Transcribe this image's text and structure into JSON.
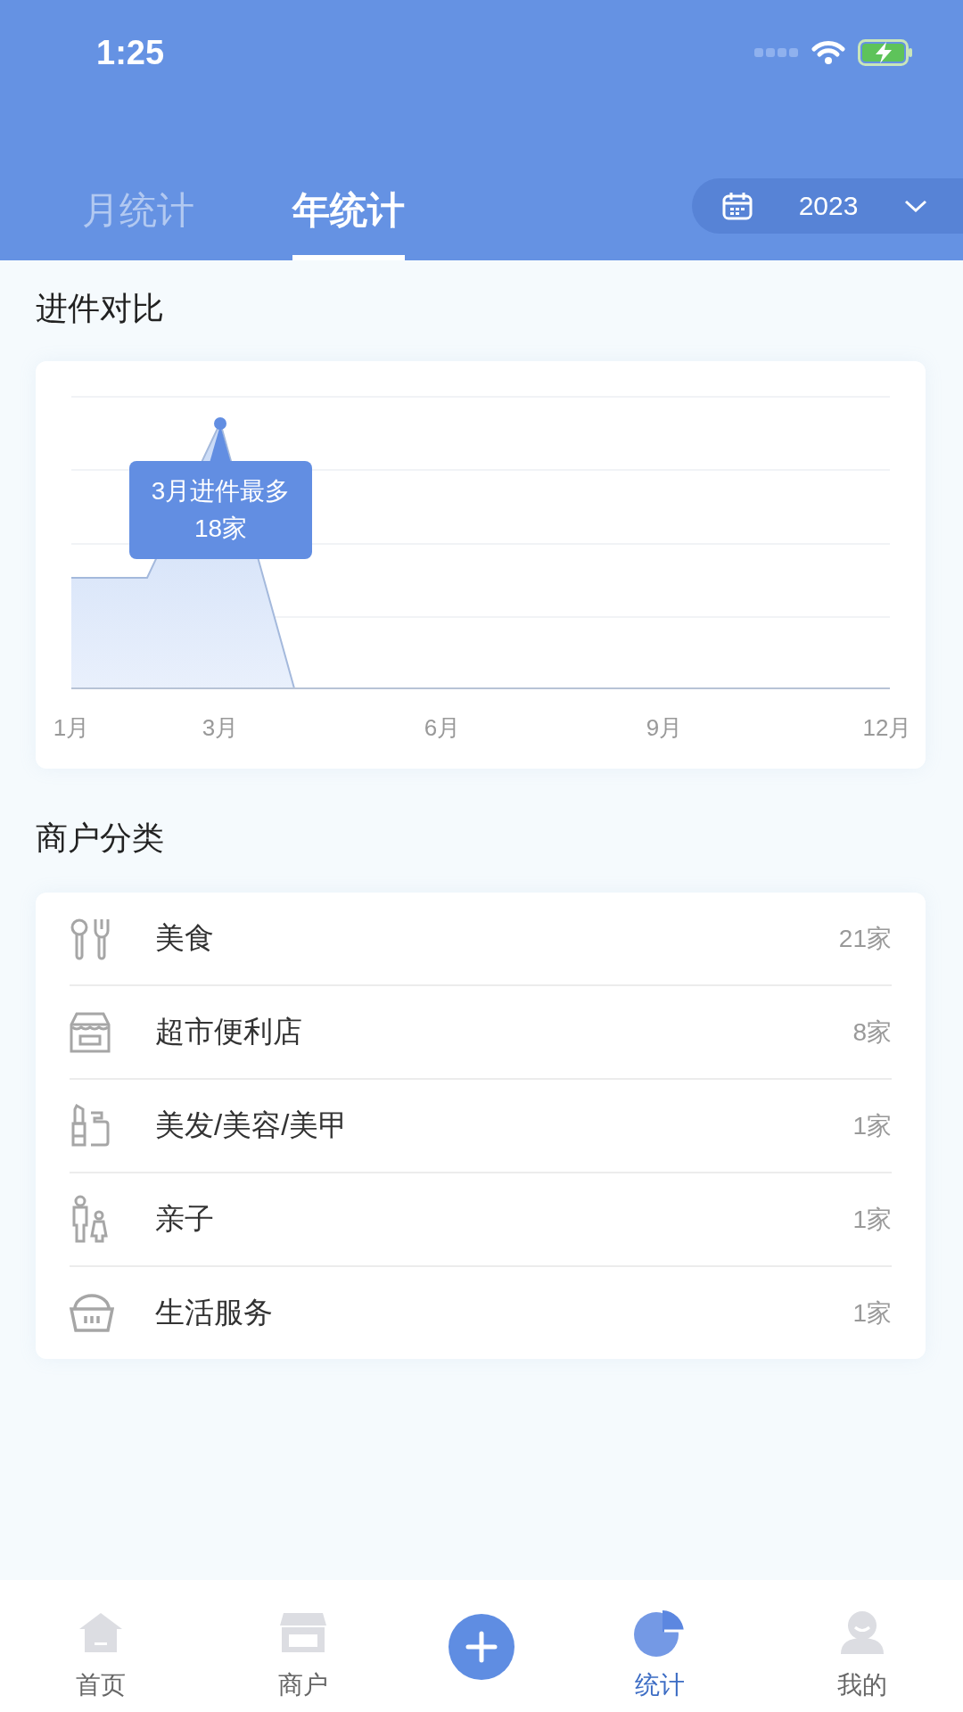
{
  "status_bar": {
    "time": "1:25"
  },
  "tabs": [
    {
      "label": "月统计",
      "selected": false
    },
    {
      "label": "年统计",
      "selected": true
    }
  ],
  "year_picker": {
    "value": "2023"
  },
  "intake_chart": {
    "title": "进件对比",
    "x_labels": [
      "1月",
      "3月",
      "6月",
      "9月",
      "12月"
    ],
    "tooltip": {
      "title": "3月进件最多",
      "value": "18家"
    }
  },
  "categories": {
    "title": "商户分类",
    "items": [
      {
        "name": "美食",
        "count": "21家"
      },
      {
        "name": "超市便利店",
        "count": "8家"
      },
      {
        "name": "美发/美容/美甲",
        "count": "1家"
      },
      {
        "name": "亲子",
        "count": "1家"
      },
      {
        "name": "生活服务",
        "count": "1家"
      }
    ]
  },
  "nav": [
    {
      "kind": "tab",
      "label": "首页",
      "selected": false
    },
    {
      "kind": "tab",
      "label": "商户",
      "selected": false
    },
    {
      "kind": "action"
    },
    {
      "kind": "tab",
      "label": "统计",
      "selected": true
    },
    {
      "kind": "tab",
      "label": "我的",
      "selected": false
    }
  ]
}
